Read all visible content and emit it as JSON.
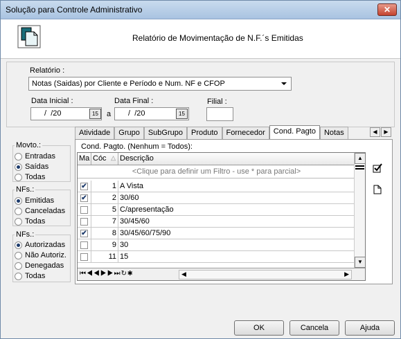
{
  "window": {
    "title": "Solução para Controle Administrativo",
    "close_label": "✕"
  },
  "header": {
    "report_title": "Relatório de Movimentação de N.F.´s Emitidas"
  },
  "form": {
    "relatorio_label": "Relatório :",
    "relatorio_value": "Notas (Saidas) por Cliente e Período e Num. NF e CFOP",
    "data_inicial_label": "Data Inicial :",
    "data_inicial_value": " /  /20",
    "data_a": "a",
    "data_final_label": "Data Final :",
    "data_final_value": " /  /20",
    "cal_label": "15",
    "filial_label": "Filial :",
    "filial_value": ""
  },
  "movto": {
    "title": "Movto.:",
    "options": [
      "Entradas",
      "Saídas",
      "Todas"
    ],
    "selected": "Saídas"
  },
  "nfs1": {
    "title": "NFs.:",
    "options": [
      "Emitidas",
      "Canceladas",
      "Todas"
    ],
    "selected": "Emitidas"
  },
  "nfs2": {
    "title": "NFs.:",
    "options": [
      "Autorizadas",
      "Não Autoriz.",
      "Denegadas",
      "Todas"
    ],
    "selected": "Autorizadas"
  },
  "tabs": [
    "Atividade",
    "Grupo",
    "SubGrupo",
    "Produto",
    "Fornecedor",
    "Cond. Pagto",
    "Notas"
  ],
  "active_tab": "Cond. Pagto",
  "panel": {
    "caption": "Cond. Pagto. (Nenhum = Todos):",
    "columns": [
      "Ma",
      "Cóc",
      "Descrição"
    ],
    "filter_hint": "<Clique para definir um Filtro - use * para parcial>",
    "rows": [
      {
        "checked": true,
        "code": "1",
        "desc": "A Vista"
      },
      {
        "checked": true,
        "code": "2",
        "desc": "30/60"
      },
      {
        "checked": false,
        "code": "5",
        "desc": "C/apresentação"
      },
      {
        "checked": false,
        "code": "7",
        "desc": "30/45/60"
      },
      {
        "checked": true,
        "code": "8",
        "desc": "30/45/60/75/90"
      },
      {
        "checked": false,
        "code": "9",
        "desc": "30"
      },
      {
        "checked": false,
        "code": "11",
        "desc": "15"
      }
    ],
    "nav_glyphs": "⏮◀◀▶▶⏭↻✱"
  },
  "buttons": {
    "ok": "OK",
    "cancelar": "Cancela",
    "ajuda": "Ajuda"
  }
}
